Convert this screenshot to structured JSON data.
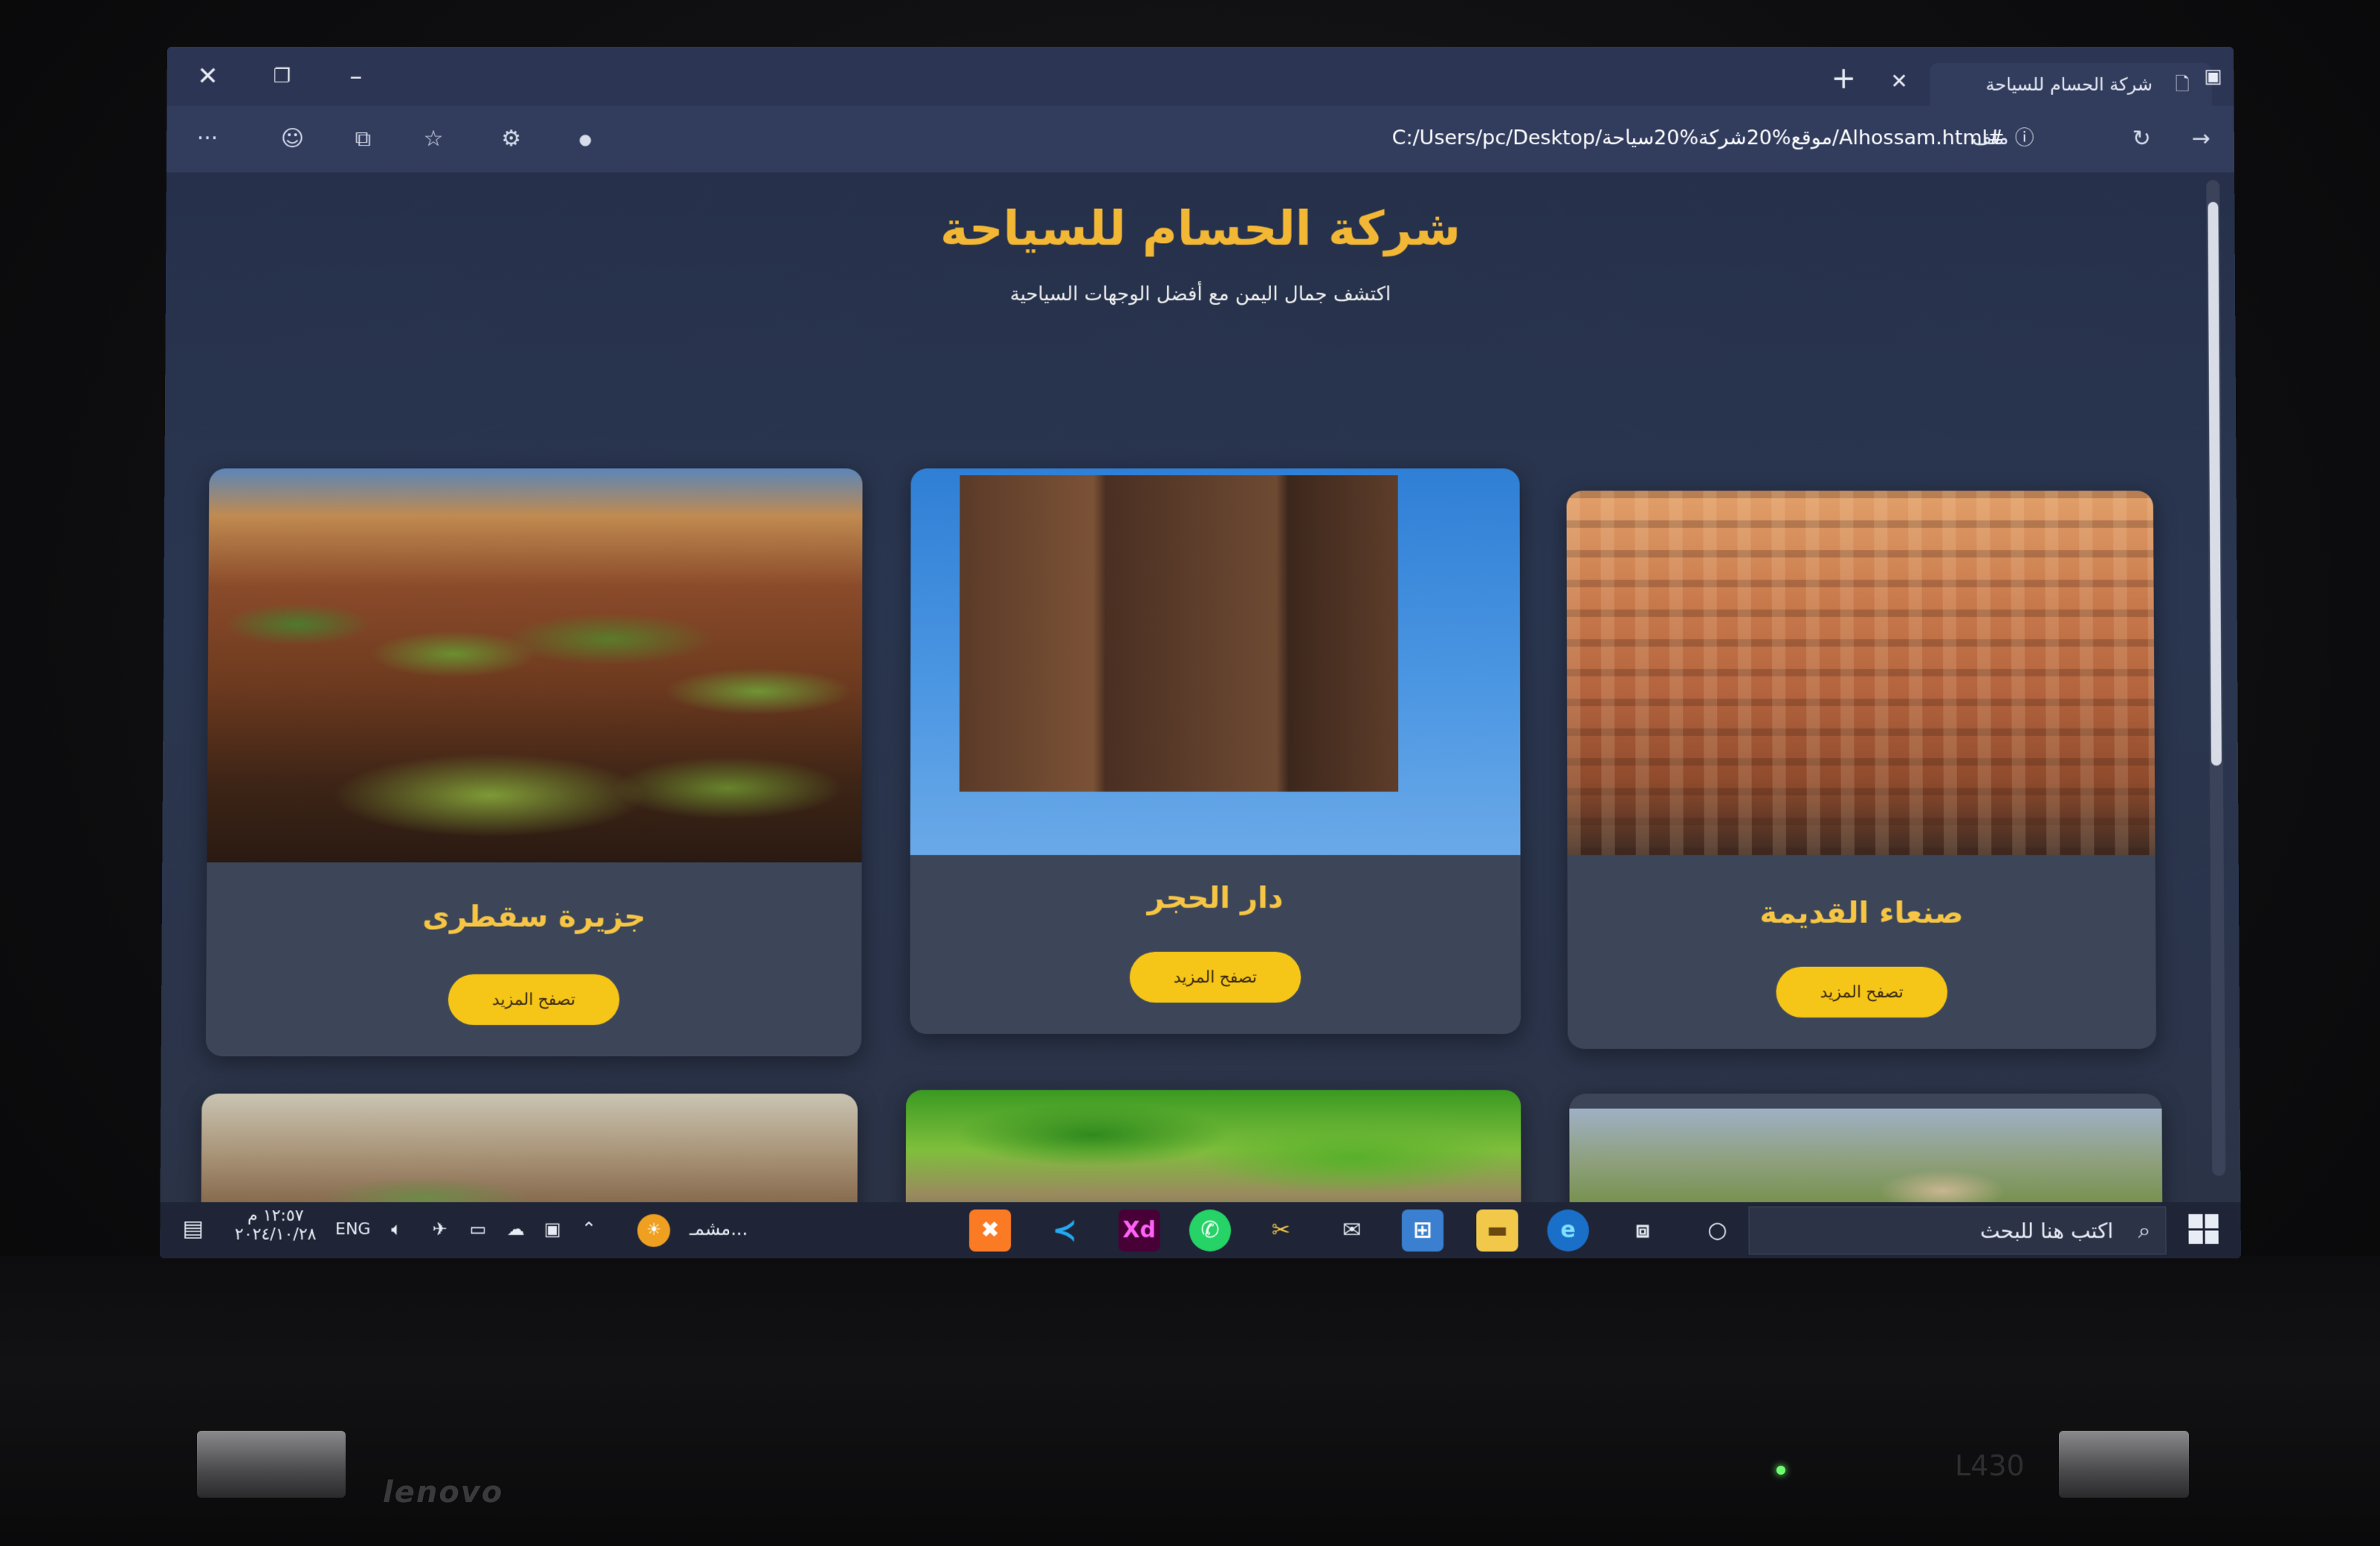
{
  "browser": {
    "tab_title": "شركة الحسام للسياحة",
    "address_label": "ملف",
    "address_url": "C:/Users/pc/Desktop/موقع%20شركة%20سياحة/Alhossam.html#",
    "more_menu": "···"
  },
  "site": {
    "title": "شركة الحسام للسياحة",
    "subtitle": "اكتشف جمال اليمن مع أفضل الوجهات السياحية"
  },
  "cards": [
    {
      "title": "صنعاء القديمة",
      "button": "تصفح المزيد"
    },
    {
      "title": "دار الحجر",
      "button": "تصفح المزيد"
    },
    {
      "title": "جزيرة سقطرى",
      "button": "تصفح المزيد"
    }
  ],
  "taskbar": {
    "search_placeholder": "اكتب هنا للبحث",
    "time": "١٢:٥٧ م",
    "date": "٢٠٢٤/١٠/٢٨",
    "language": "ENG",
    "weather_label": "مشمـ..."
  },
  "laptop": {
    "brand": "lenovo",
    "model": "L430"
  },
  "colors": {
    "accent": "#f2b735",
    "button": "#f5c518",
    "page_bg": "#2a3650"
  }
}
